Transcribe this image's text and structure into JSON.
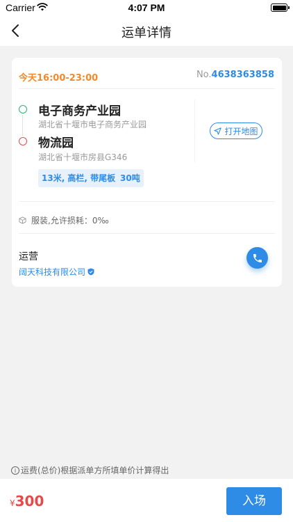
{
  "status_bar": {
    "carrier": "Carrier",
    "time": "4:07 PM"
  },
  "nav": {
    "title": "运单详情"
  },
  "order": {
    "time_range": "今天16:00-23:00",
    "no_prefix": "No.",
    "no_value": "4638363858"
  },
  "route": {
    "from": {
      "name": "电子商务产业园",
      "address": "湖北省十堰市电子商务产业园"
    },
    "to": {
      "name": "物流园",
      "address": "湖北省十堰市房县G346"
    },
    "map_button": "打开地图"
  },
  "tags": [
    "13米, 高栏, 带尾板",
    "30吨"
  ],
  "goods": {
    "text": "服装,允许损耗：0‰"
  },
  "operator": {
    "label": "运营",
    "company": "阔天科技有限公司"
  },
  "notice": {
    "text": "运费(总价)根据派单方所填单价计算得出"
  },
  "footer": {
    "currency": "¥",
    "price": "300",
    "action": "入场"
  },
  "colors": {
    "accent": "#2e8be6",
    "orange": "#f08a2a",
    "red": "#e34b4b",
    "green": "#2ab56c"
  }
}
